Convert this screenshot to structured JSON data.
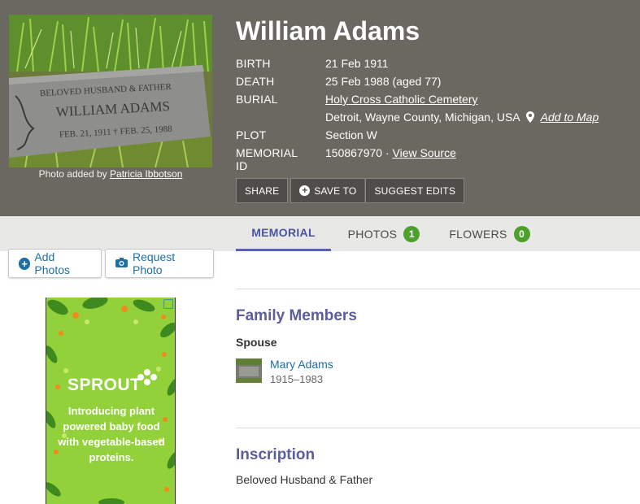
{
  "memorial": {
    "name": "William Adams",
    "photo_caption_prefix": "Photo added by",
    "photo_added_by": "Patricia Ibbotson",
    "headstone_lines": [
      "BELOVED HUSBAND & FATHER",
      "WILLIAM ADAMS",
      "FEB. 21, 1911",
      "FEB. 25, 1988"
    ],
    "facts": {
      "birth_label": "BIRTH",
      "birth_value": "21 Feb 1911",
      "death_label": "DEATH",
      "death_value": "25 Feb 1988 (aged 77)",
      "burial_label": "BURIAL",
      "burial_value": "Holy Cross Catholic Cemetery",
      "burial_location": "Detroit, Wayne County, Michigan, USA",
      "add_to_map": "Add to Map",
      "plot_label": "PLOT",
      "plot_value": "Section W",
      "memorial_id_label": "MEMORIAL ID",
      "memorial_id_value": "150867970 ·",
      "view_source": "View Source"
    },
    "buttons": {
      "share": "SHARE",
      "save_to": "SAVE TO",
      "suggest_edits": "SUGGEST EDITS"
    }
  },
  "tabs": [
    {
      "label": "MEMORIAL",
      "active": true
    },
    {
      "label": "PHOTOS",
      "count": "1"
    },
    {
      "label": "FLOWERS",
      "count": "0"
    }
  ],
  "sidebar": {
    "add_photos": "Add Photos",
    "request_photo": "Request Photo"
  },
  "ad": {
    "brand": "SPROUT",
    "text": "Introducing plant powered baby food with vegetable-based proteins."
  },
  "family": {
    "title": "Family Members",
    "spouse_label": "Spouse",
    "spouse_name": "Mary Adams",
    "spouse_dates": "1915–1983"
  },
  "inscription": {
    "title": "Inscription",
    "text": "Beloved Husband & Father"
  },
  "colors": {
    "header_bg": "#6b6862",
    "link": "#1d6fa5",
    "section_title": "#5b5e9b",
    "badge": "#4ea02c",
    "ad_bg": "#93d13b"
  }
}
